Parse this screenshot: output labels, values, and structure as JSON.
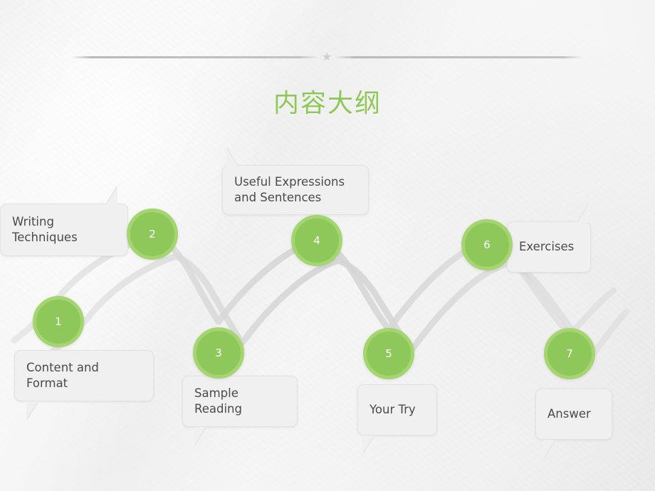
{
  "slide": {
    "title": "内容大纲",
    "title_color": "#8dc857",
    "background_color": "#f4f4f4",
    "accent_color": "#8ec85a",
    "callout_bg_color": "#f0f0f0",
    "divider_star_glyph": "★"
  },
  "diagram": {
    "type": "wave-timeline",
    "node_count": 7,
    "nodes": [
      {
        "number": "1",
        "label": "Content and Format",
        "position": "low"
      },
      {
        "number": "2",
        "label": "Writing Techniques",
        "position": "high"
      },
      {
        "number": "3",
        "label": "Sample Reading",
        "position": "low"
      },
      {
        "number": "4",
        "label": "Useful Expressions\nand Sentences",
        "position": "high"
      },
      {
        "number": "5",
        "label": "Your Try",
        "position": "low"
      },
      {
        "number": "6",
        "label": "Exercises",
        "position": "high"
      },
      {
        "number": "7",
        "label": "Answer",
        "position": "low"
      }
    ]
  }
}
